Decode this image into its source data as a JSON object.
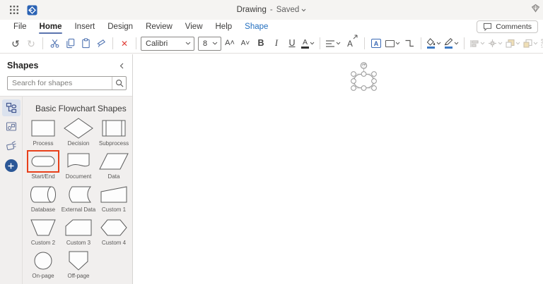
{
  "titlebar": {
    "doc_title": "Drawing",
    "dash": "-",
    "save_status": "Saved"
  },
  "menubar": {
    "file": "File",
    "home": "Home",
    "insert": "Insert",
    "design": "Design",
    "review": "Review",
    "view": "View",
    "help": "Help",
    "shape": "Shape",
    "comments": "Comments"
  },
  "toolbar": {
    "undo": "↺",
    "redo": "↻",
    "font_name": "Calibri",
    "font_size": "8",
    "grow_font": "A˄",
    "shrink_font": "A˅",
    "bold": "B",
    "italic": "I",
    "underline": "U",
    "font_color": "A",
    "text_box": "A",
    "delete": "✕"
  },
  "shapes_panel": {
    "title": "Shapes",
    "search_placeholder": "Search for shapes",
    "section_title": "Basic Flowchart Shapes",
    "shapes": [
      {
        "label": "Process"
      },
      {
        "label": "Decision"
      },
      {
        "label": "Subprocess"
      },
      {
        "label": "Start/End",
        "selected": "true"
      },
      {
        "label": "Document"
      },
      {
        "label": "Data"
      },
      {
        "label": "Database"
      },
      {
        "label": "External Data"
      },
      {
        "label": "Custom 1"
      },
      {
        "label": "Custom 2"
      },
      {
        "label": "Custom 3"
      },
      {
        "label": "Custom 4"
      },
      {
        "label": "On-page"
      },
      {
        "label": "Off-page"
      }
    ]
  },
  "colors": {
    "accent_blue": "#2470c0",
    "tab_underline": "#5b74ae",
    "icon_blue": "#5477b4",
    "delete_red": "#e0403a",
    "selection_red": "#e8401a",
    "rail_selected_bg": "#dbe2ee",
    "add_button_blue": "#2b5797"
  }
}
